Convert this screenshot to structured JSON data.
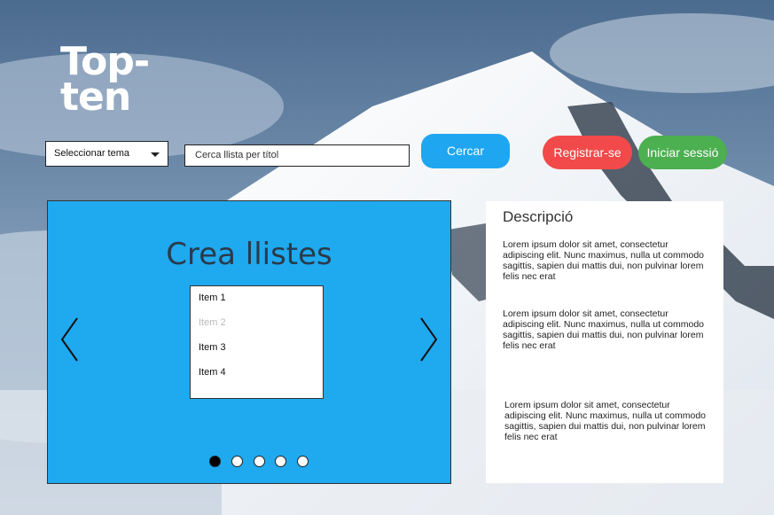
{
  "logo": {
    "line1": "Top-",
    "line2": "ten"
  },
  "topic_select": {
    "value": "Seleccionar tema"
  },
  "search": {
    "placeholder": "Cerca llista per títol"
  },
  "buttons": {
    "search": "Cercar",
    "register": "Registrar-se",
    "login": "Iniciar sessió"
  },
  "carousel": {
    "title": "Crea llistes",
    "items": [
      "Item 1",
      "Item 2",
      "Item 3",
      "Item 4"
    ],
    "active_dot": 1,
    "dot_count": 5
  },
  "description": {
    "title": "Descripció",
    "paragraphs": [
      "Lorem ipsum dolor sit amet, consectetur adipiscing elit. Nunc maximus, nulla ut commodo sagittis, sapien dui mattis dui, non pulvinar lorem felis nec erat",
      "Lorem ipsum dolor sit amet, consectetur adipiscing elit. Nunc maximus, nulla ut commodo sagittis, sapien dui mattis dui, non pulvinar lorem felis nec erat",
      "Lorem ipsum dolor sit amet, consectetur adipiscing elit. Nunc maximus, nulla ut commodo sagittis, sapien dui mattis dui, non pulvinar lorem felis nec erat"
    ]
  },
  "colors": {
    "search_button": "#1ea7f0",
    "register_button": "#f24a4a",
    "login_button": "#4caf50",
    "carousel_bg": "#1fa9ef"
  }
}
